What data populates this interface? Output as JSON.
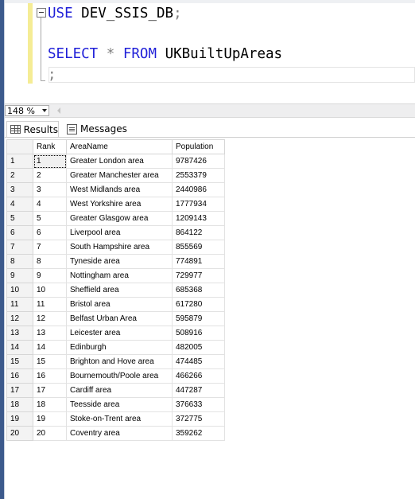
{
  "editor": {
    "lines": [
      {
        "keyword": "USE",
        "identifier": "DEV_SSIS_DB",
        "punct": ";"
      },
      {
        "keyword": "SELECT",
        "star": "*",
        "keyword2": "FROM",
        "identifier": "UKBuiltUpAreas"
      },
      {
        "punct": ";"
      }
    ]
  },
  "zoom": {
    "value": "148 %"
  },
  "tabs": {
    "results": "Results",
    "messages": "Messages"
  },
  "grid": {
    "columns": [
      "Rank",
      "AreaName",
      "Population"
    ],
    "rows": [
      {
        "n": "1",
        "rank": "1",
        "area": "Greater London area",
        "pop": "9787426"
      },
      {
        "n": "2",
        "rank": "2",
        "area": "Greater Manchester area",
        "pop": "2553379"
      },
      {
        "n": "3",
        "rank": "3",
        "area": "West Midlands area",
        "pop": "2440986"
      },
      {
        "n": "4",
        "rank": "4",
        "area": "West Yorkshire area",
        "pop": "1777934"
      },
      {
        "n": "5",
        "rank": "5",
        "area": "Greater Glasgow area",
        "pop": "1209143"
      },
      {
        "n": "6",
        "rank": "6",
        "area": "Liverpool area",
        "pop": "864122"
      },
      {
        "n": "7",
        "rank": "7",
        "area": "South Hampshire area",
        "pop": "855569"
      },
      {
        "n": "8",
        "rank": "8",
        "area": "Tyneside area",
        "pop": "774891"
      },
      {
        "n": "9",
        "rank": "9",
        "area": "Nottingham area",
        "pop": "729977"
      },
      {
        "n": "10",
        "rank": "10",
        "area": "Sheffield area",
        "pop": "685368"
      },
      {
        "n": "11",
        "rank": "11",
        "area": "Bristol area",
        "pop": "617280"
      },
      {
        "n": "12",
        "rank": "12",
        "area": "Belfast Urban Area",
        "pop": "595879"
      },
      {
        "n": "13",
        "rank": "13",
        "area": "Leicester area",
        "pop": "508916"
      },
      {
        "n": "14",
        "rank": "14",
        "area": "Edinburgh",
        "pop": "482005"
      },
      {
        "n": "15",
        "rank": "15",
        "area": "Brighton and Hove area",
        "pop": "474485"
      },
      {
        "n": "16",
        "rank": "16",
        "area": "Bournemouth/Poole area",
        "pop": "466266"
      },
      {
        "n": "17",
        "rank": "17",
        "area": "Cardiff area",
        "pop": "447287"
      },
      {
        "n": "18",
        "rank": "18",
        "area": "Teesside area",
        "pop": "376633"
      },
      {
        "n": "19",
        "rank": "19",
        "area": "Stoke-on-Trent area",
        "pop": "372775"
      },
      {
        "n": "20",
        "rank": "20",
        "area": "Coventry area",
        "pop": "359262"
      }
    ]
  }
}
